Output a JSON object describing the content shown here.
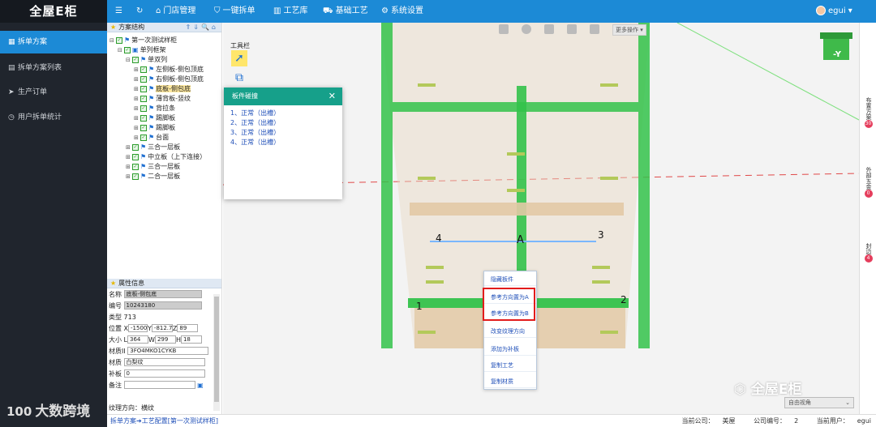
{
  "app": {
    "logo": "全屋E柜",
    "colors": {
      "primary": "#1c8ad6",
      "nav_bg": "#20252d",
      "dialog_header": "#16a08a",
      "cabinet_green": "#33c24a",
      "badge": "#e53d5c"
    }
  },
  "topnav": {
    "menu_icon": "hamburger-icon",
    "refresh_icon": "refresh-icon",
    "items": [
      {
        "icon": "house-icon",
        "label": "门店管理"
      },
      {
        "icon": "shield-icon",
        "label": "一键拆单"
      },
      {
        "icon": "bars-icon",
        "label": "工艺库"
      },
      {
        "icon": "car-icon",
        "label": "基础工艺"
      },
      {
        "icon": "gear-icon",
        "label": "系统设置"
      }
    ],
    "user": "egui"
  },
  "sidebar": {
    "items": [
      {
        "icon": "grid-icon",
        "label": "拆单方案",
        "active": true
      },
      {
        "icon": "list-icon",
        "label": "拆单方案列表",
        "active": false
      },
      {
        "icon": "send-icon",
        "label": "生产订单",
        "active": false
      },
      {
        "icon": "clock-icon",
        "label": "用户拆单统计",
        "active": false
      }
    ]
  },
  "watermark": {
    "left": "大数跨境",
    "right": "全屋E柜"
  },
  "tree": {
    "header": "方案结构",
    "nodes": [
      {
        "label": "第一次测试样柜"
      },
      {
        "label": "单列框架"
      },
      {
        "label": "单双列"
      },
      {
        "label": "左侧板-侧包顶底"
      },
      {
        "label": "右侧板-侧包顶底"
      },
      {
        "label": "底板-侧包底",
        "selected": true
      },
      {
        "label": "薄背板-竖纹"
      },
      {
        "label": "背拉条"
      },
      {
        "label": "踢脚板"
      },
      {
        "label": "踢脚板"
      },
      {
        "label": "台面"
      },
      {
        "label": "三合一层板"
      },
      {
        "label": "中立板（上下连接）"
      },
      {
        "label": "三合一层板"
      },
      {
        "label": "二合一层板"
      }
    ]
  },
  "props": {
    "header": "属性信息",
    "name_label": "名称",
    "name": "底板-侧包底",
    "code_label": "编号",
    "code": "10243180",
    "type_label": "类型",
    "type": "713",
    "pos_label": "位置",
    "pos": {
      "xl": "X",
      "x": "-1500.",
      "yl": "Y",
      "y": "-812.7",
      "zl": "Z",
      "z": "89"
    },
    "size_label": "大小",
    "size": {
      "ll": "L",
      "l": "364",
      "wl": "W",
      "w": "299",
      "hl": "H",
      "h": "18"
    },
    "matcode_label": "材质II",
    "matcode": "3FO4MKO1CYKB",
    "material_label": "材质",
    "material": "白梨纹",
    "patch_label": "补板",
    "patch": "0",
    "note_label": "备注",
    "note": "",
    "grain_label": "纹理方向：",
    "grain": "横纹"
  },
  "viewport": {
    "toolbox_label": "工具栏",
    "more_ops": "更多操作",
    "view_mode": "自由视角",
    "axis_cube": "-Y",
    "corner_labels": [
      "1",
      "2",
      "3",
      "4",
      "A"
    ]
  },
  "dialog": {
    "title": "板件碰撞",
    "items": [
      "1、正常（出槽）",
      "2、正常（出槽）",
      "3、正常（出槽）",
      "4、正常（出槽）"
    ]
  },
  "context_menu": {
    "items": [
      "隐藏板件",
      "参考方向置为A",
      "参考方向置为B",
      "改变纹理方向",
      "添加为补板",
      "复制工艺",
      "复制材质"
    ]
  },
  "rightbar": {
    "tabs": [
      {
        "label": "布置方案",
        "count": "30"
      },
      {
        "label": "外部五金",
        "count": "0"
      },
      {
        "label": "封边",
        "count": "4"
      }
    ]
  },
  "statusbar": {
    "breadcrumbs": "拆单方案➔工艺配置[第一次测试样柜]",
    "company_label": "当前公司：",
    "company": "美屋",
    "company_code_label": "公司编号：",
    "company_code": "2",
    "user_label": "当前用户：",
    "user": "egui"
  }
}
